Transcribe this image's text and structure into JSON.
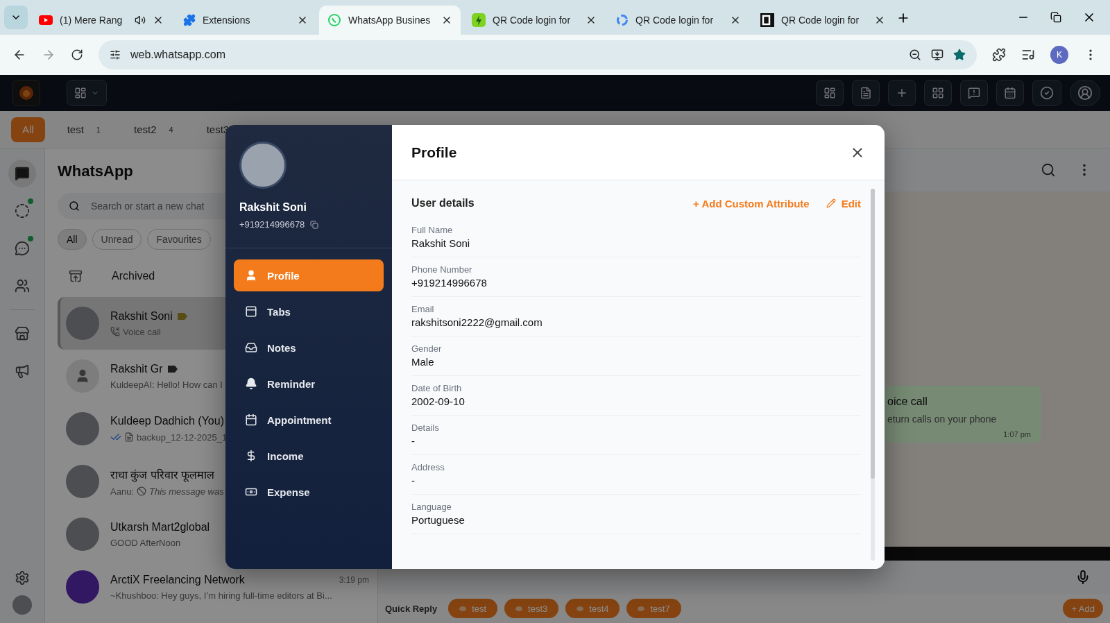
{
  "browser": {
    "tabs": [
      {
        "title": "(1) Mere Rang",
        "selected": false,
        "audio": true
      },
      {
        "title": "Extensions",
        "selected": false,
        "audio": false
      },
      {
        "title": "WhatsApp Busines",
        "selected": true,
        "audio": false
      },
      {
        "title": "QR Code login for",
        "selected": false,
        "audio": false
      },
      {
        "title": "QR Code login for",
        "selected": false,
        "audio": false
      },
      {
        "title": "QR Code login for",
        "selected": false,
        "audio": false
      }
    ],
    "address": "web.whatsapp.com",
    "profile_initial": "K"
  },
  "label_tabs": [
    {
      "label": "All",
      "selected": true
    },
    {
      "label": "test",
      "count": "1",
      "selected": false
    },
    {
      "label": "test2",
      "count": "4",
      "selected": false
    },
    {
      "label": "test3",
      "selected": false
    }
  ],
  "rail": [
    {
      "selected": true,
      "dot": false
    },
    {
      "selected": false,
      "dot": true
    },
    {
      "selected": false,
      "dot": true
    },
    {
      "selected": false,
      "dot": false
    },
    {
      "selected": false,
      "dot": false
    },
    {
      "selected": false,
      "dot": false
    }
  ],
  "chat_list": {
    "title": "WhatsApp",
    "search_placeholder": "Search or start a new chat",
    "filters": [
      {
        "label": "All",
        "selected": true
      },
      {
        "label": "Unread",
        "selected": false
      },
      {
        "label": "Favourites",
        "selected": false
      }
    ],
    "archived": "Archived",
    "chats": [
      {
        "name": "Rakshit Soni",
        "preview": {
          "kind": "call",
          "text": "Voice call"
        },
        "color": "#584c17",
        "kind": "photo",
        "selected": true
      },
      {
        "name": "Rakshit Gr",
        "preview": {
          "kind": "text",
          "text": "KuldeepAI: Hello! How can I"
        },
        "color": "#1c1c1c",
        "kind": "person",
        "selected": false
      },
      {
        "name": "Kuldeep Dadhich (You)",
        "preview": {
          "kind": "doc",
          "text": "backup_12-12-2025_1"
        },
        "kind": "photo",
        "selected": false
      },
      {
        "name": "राधा कुंज परिवार फूलमाल",
        "preview": {
          "kind": "deleted",
          "sender": "Aanu:",
          "text": "This message was"
        },
        "kind": "photo",
        "selected": false
      },
      {
        "name": "Utkarsh Mart2global",
        "preview": {
          "kind": "text",
          "text": "GOOD AfterNoon"
        },
        "kind": "photo",
        "selected": false
      },
      {
        "name": "ArctiX Freelancing Network",
        "preview": {
          "kind": "text",
          "text": "~Khushboo: Hey guys, I’m hiring full-time editors at Bi..."
        },
        "time": "3:19 pm",
        "kind": "logo",
        "selected": false
      }
    ]
  },
  "chat_pane": {
    "bubble": {
      "title": "oice call",
      "subtitle": "eturn calls on your phone",
      "time": "1:07 pm"
    }
  },
  "quick_reply": {
    "label": "Quick Reply",
    "chips": [
      "test",
      "test3",
      "test4",
      "test7"
    ],
    "add": "+ Add"
  },
  "modal": {
    "contact": {
      "name": "Rakshit Soni",
      "phone": "+919214996678"
    },
    "menu": [
      {
        "label": "Profile",
        "selected": true
      },
      {
        "label": "Tabs",
        "selected": false
      },
      {
        "label": "Notes",
        "selected": false
      },
      {
        "label": "Reminder",
        "selected": false
      },
      {
        "label": "Appointment",
        "selected": false
      },
      {
        "label": "Income",
        "selected": false
      },
      {
        "label": "Expense",
        "selected": false
      }
    ],
    "title": "Profile",
    "section": "User details",
    "add_attribute": "+ Add Custom Attribute",
    "edit": "Edit",
    "fields": [
      {
        "label": "Full Name",
        "value": "Rakshit Soni"
      },
      {
        "label": "Phone Number",
        "value": "+919214996678"
      },
      {
        "label": "Email",
        "value": "rakshitsoni2222@gmail.com"
      },
      {
        "label": "Gender",
        "value": "Male"
      },
      {
        "label": "Date of Birth",
        "value": "2002-09-10"
      },
      {
        "label": "Details",
        "value": "-"
      },
      {
        "label": "Address",
        "value": "-"
      },
      {
        "label": "Language",
        "value": "Portuguese"
      }
    ]
  }
}
